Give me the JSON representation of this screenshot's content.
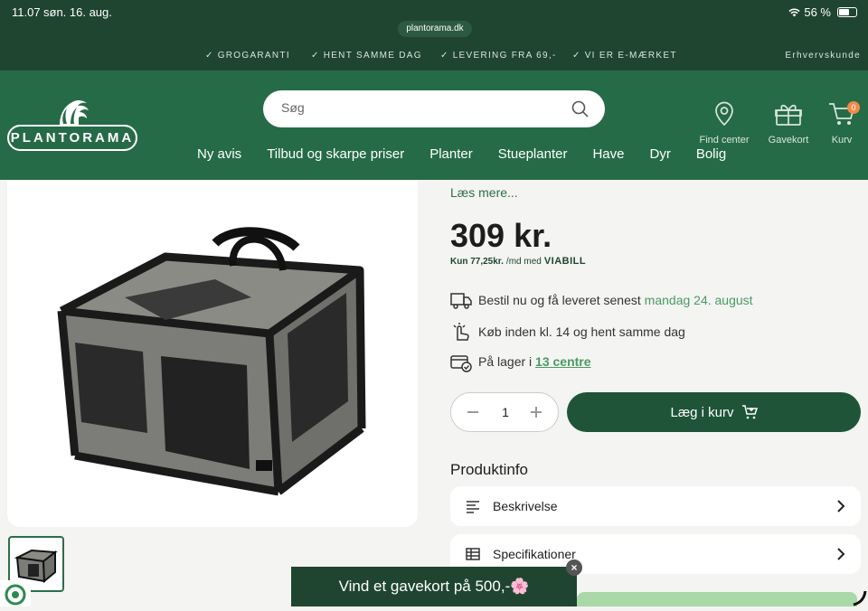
{
  "status_bar": {
    "time": "11.07",
    "date": "søn. 16. aug.",
    "url": "plantorama.dk",
    "battery": "56 %"
  },
  "usp": {
    "items": [
      "GROGARANTI",
      "HENT SAMME DAG",
      "LEVERING FRA 69,-",
      "VI ER E-MÆRKET"
    ],
    "business": "Erhvervskunde"
  },
  "header": {
    "logo_text": "PLANTORAMA",
    "search_placeholder": "Søg",
    "find_center": "Find center",
    "gift_card": "Gavekort",
    "cart": "Kurv",
    "cart_count": "0"
  },
  "nav": [
    "Ny avis",
    "Tilbud og skarpe priser",
    "Planter",
    "Stueplanter",
    "Have",
    "Dyr",
    "Bolig"
  ],
  "product": {
    "read_more": "Læs mere...",
    "price": "309 kr.",
    "installment_prefix": "Kun 77,25kr.",
    "installment_suffix": "/md med",
    "installment_brand": "VIABILL",
    "delivery_text": "Bestil nu og få leveret senest",
    "delivery_date": "mandag 24. august",
    "pickup_text": "Køb inden kl. 14 og hent samme dag",
    "stock_text": "På lager i",
    "stock_link": "13 centre",
    "quantity": "1",
    "add_to_cart": "Læg i kurv"
  },
  "product_info": {
    "title": "Produktinfo",
    "description": "Beskrivelse",
    "specifications": "Specifikationer"
  },
  "banner": {
    "text": "Vind et gavekort på 500,-🌸"
  },
  "colors": {
    "dark_green": "#1f4530",
    "header_green": "#266b47",
    "accent_green": "#4a9a63",
    "badge_orange": "#f08a4b"
  }
}
